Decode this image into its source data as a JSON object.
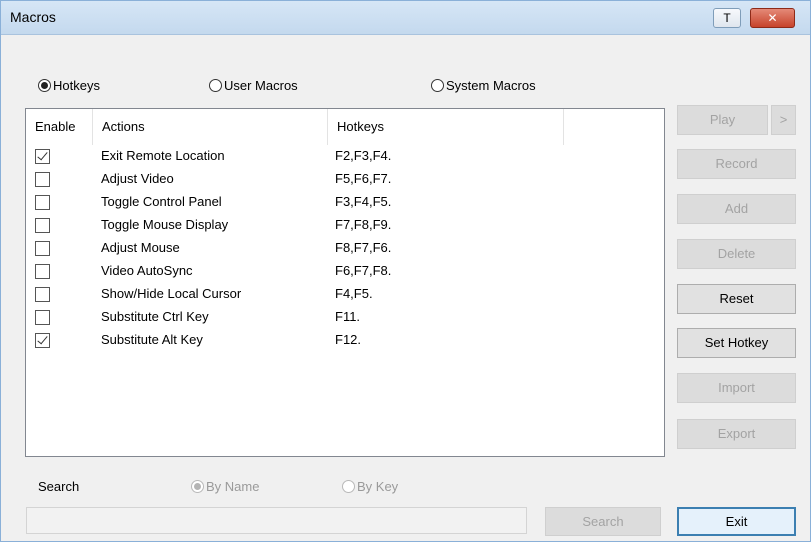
{
  "window": {
    "title": "Macros",
    "pin_label": "T",
    "close_label": "✕"
  },
  "mode": {
    "options": [
      {
        "label": "Hotkeys",
        "selected": true
      },
      {
        "label": "User Macros",
        "selected": false
      },
      {
        "label": "System Macros",
        "selected": false
      }
    ]
  },
  "list": {
    "columns": [
      "Enable",
      "Actions",
      "Hotkeys"
    ],
    "rows": [
      {
        "enabled": true,
        "action": "Exit Remote Location",
        "hotkey": "F2,F3,F4."
      },
      {
        "enabled": false,
        "action": "Adjust Video",
        "hotkey": "F5,F6,F7."
      },
      {
        "enabled": false,
        "action": "Toggle Control Panel",
        "hotkey": "F3,F4,F5."
      },
      {
        "enabled": false,
        "action": "Toggle Mouse Display",
        "hotkey": "F7,F8,F9."
      },
      {
        "enabled": false,
        "action": "Adjust Mouse",
        "hotkey": "F8,F7,F6."
      },
      {
        "enabled": false,
        "action": "Video AutoSync",
        "hotkey": "F6,F7,F8."
      },
      {
        "enabled": false,
        "action": "Show/Hide Local Cursor",
        "hotkey": "F4,F5."
      },
      {
        "enabled": false,
        "action": "Substitute Ctrl Key",
        "hotkey": "F11."
      },
      {
        "enabled": true,
        "action": "Substitute Alt Key",
        "hotkey": "F12."
      }
    ]
  },
  "buttons": {
    "play": "Play",
    "more": ">",
    "record": "Record",
    "add": "Add",
    "delete": "Delete",
    "reset": "Reset",
    "set_hotkey": "Set Hotkey",
    "import": "Import",
    "export": "Export",
    "search": "Search",
    "exit": "Exit"
  },
  "search": {
    "label": "Search",
    "by_name": "By Name",
    "by_key": "By Key",
    "by_name_selected": true,
    "value": ""
  }
}
